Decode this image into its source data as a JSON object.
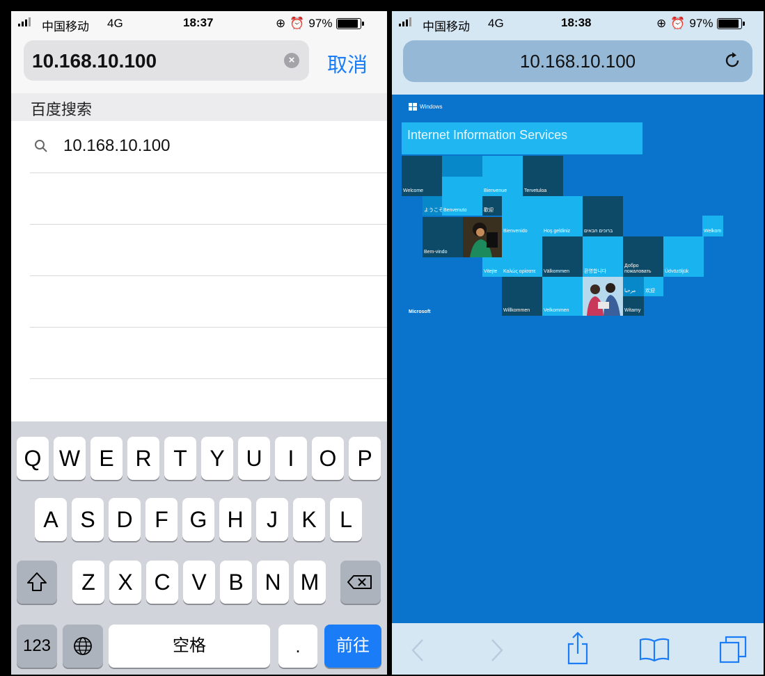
{
  "left_phone": {
    "status": {
      "carrier": "中国移动",
      "network": "4G",
      "time": "18:37",
      "battery": "97%",
      "battery_level": 0.97
    },
    "url_field_value": "10.168.10.100",
    "cancel_label": "取消",
    "section_header": "百度搜索",
    "suggestion": "10.168.10.100",
    "keyboard": {
      "row1": [
        "Q",
        "W",
        "E",
        "R",
        "T",
        "Y",
        "U",
        "I",
        "O",
        "P"
      ],
      "row2": [
        "A",
        "S",
        "D",
        "F",
        "G",
        "H",
        "J",
        "K",
        "L"
      ],
      "row3": [
        "Z",
        "X",
        "C",
        "V",
        "B",
        "N",
        "M"
      ],
      "numbers_key": "123",
      "space_key": "空格",
      "period_key": ".",
      "go_key": "前往"
    }
  },
  "right_phone": {
    "status": {
      "carrier": "中国移动",
      "network": "4G",
      "time": "18:38",
      "battery": "97%",
      "battery_level": 0.97
    },
    "url_display": "10.168.10.100",
    "page": {
      "windows_label": "Windows",
      "banner_title": "Internet Information Services",
      "tiles": {
        "welcome": "Welcome",
        "bienvenue": "Bienvenue",
        "tervetuloa": "Tervetuloa",
        "youkoso": "ようこそ",
        "benvenuto": "Benvenuto",
        "huanying": "歡迎",
        "bienvenido": "Bienvenido",
        "hos_geldiniz": "Hoş geldiniz",
        "hebrew": "ברוכים הבאים",
        "welkom": "Welkom",
        "bem_vindo": "Bem-vindo",
        "vitejte": "Vitejte",
        "kalos_orisate": "Καλώς ορίσατε",
        "valkommen_sv": "Välkommen",
        "korean": "환영합니다",
        "dobro": "Добро пожаловать",
        "udvozoljuk": "Üdvözöljük",
        "arabic": "مرحبا",
        "huanying_cn": "欢迎",
        "willkommen": "Willkommen",
        "velkommen": "Velkommen",
        "witamy": "Witamy"
      },
      "microsoft_label": "Microsoft"
    }
  }
}
